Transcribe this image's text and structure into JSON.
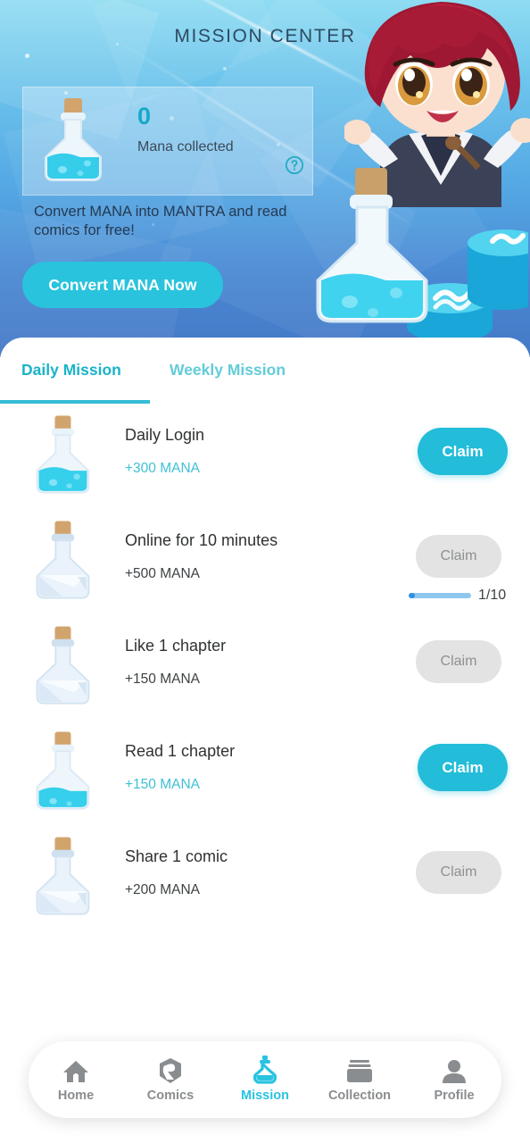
{
  "banner": {
    "title": "MISSION CENTER",
    "mana_card": {
      "count": "0",
      "label": "Mana collected",
      "help_icon": "question-circle-icon",
      "bottle_icon": "potion-bottle-filled-icon"
    },
    "promo_text": "Convert MANA into MANTRA and read comics for free!",
    "convert_button": "Convert MANA Now",
    "art": {
      "character": "chibi-character-illustration",
      "potion": "large-potion-bottle-illustration",
      "coins": "mantra-coin-stack-illustration"
    }
  },
  "tabs": [
    {
      "label": "Daily Mission",
      "active": true
    },
    {
      "label": "Weekly Mission",
      "active": false
    }
  ],
  "missions": [
    {
      "title": "Daily Login",
      "reward": "+300 MANA",
      "claimable": true,
      "claim_label": "Claim",
      "bottle": "potion-bottle-filled-icon"
    },
    {
      "title": "Online for 10 minutes",
      "reward": "+500 MANA",
      "claimable": false,
      "claim_label": "Claim",
      "bottle": "potion-bottle-empty-icon",
      "progress": {
        "text": "1/10",
        "percent": 10
      }
    },
    {
      "title": "Like 1 chapter",
      "reward": "+150 MANA",
      "claimable": false,
      "claim_label": "Claim",
      "bottle": "potion-bottle-empty-icon"
    },
    {
      "title": "Read 1 chapter",
      "reward": "+150 MANA",
      "claimable": true,
      "claim_label": "Claim",
      "bottle": "potion-bottle-filled-icon"
    },
    {
      "title": "Share 1 comic",
      "reward": "+200 MANA",
      "claimable": false,
      "claim_label": "Claim",
      "bottle": "potion-bottle-empty-icon"
    }
  ],
  "bottom_nav": [
    {
      "label": "Home",
      "icon": "home-icon",
      "active": false
    },
    {
      "label": "Comics",
      "icon": "comics-icon",
      "active": false
    },
    {
      "label": "Mission",
      "icon": "potion-icon",
      "active": true
    },
    {
      "label": "Collection",
      "icon": "collection-cards-icon",
      "active": false
    },
    {
      "label": "Profile",
      "icon": "person-icon",
      "active": false
    }
  ],
  "colors": {
    "accent": "#29c3dd",
    "accent_dark": "#17a8c9",
    "tab_active": "#1ab3c9",
    "tab_inactive": "#63ccd8",
    "claim_disabled_bg": "#e3e3e3",
    "progress_fill": "#2f8fe0",
    "progress_track": "#8fc7ef"
  }
}
